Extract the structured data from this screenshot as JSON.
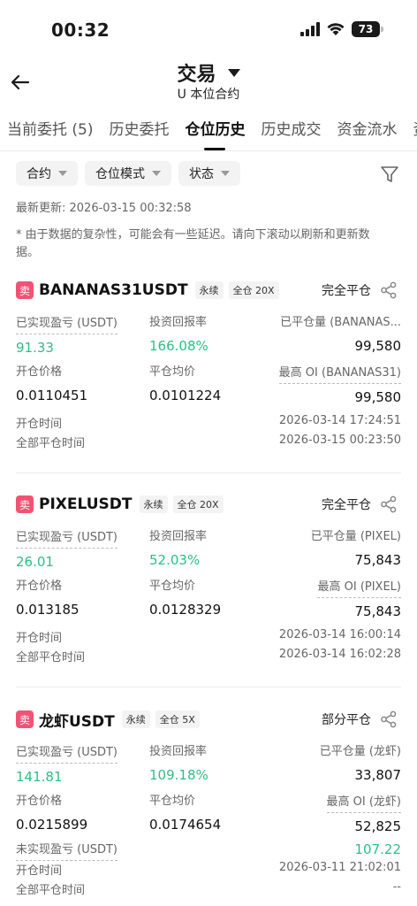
{
  "status_bar": {
    "time": "00:32",
    "battery": "73"
  },
  "header": {
    "title": "交易",
    "subtitle": "U 本位合约"
  },
  "tabs": [
    {
      "label": "当前委托 (5)"
    },
    {
      "label": "历史委托"
    },
    {
      "label": "仓位历史",
      "active": true
    },
    {
      "label": "历史成交"
    },
    {
      "label": "资金流水"
    },
    {
      "label": "资"
    }
  ],
  "filters": [
    {
      "label": "合约"
    },
    {
      "label": "仓位模式"
    },
    {
      "label": "状态"
    }
  ],
  "last_update": "最新更新: 2026-03-15 00:32:58",
  "notice": "* 由于数据的复杂性，可能会有一些延迟。请向下滚动以刷新和更新数据。",
  "colors": {
    "green": "#2ebd85",
    "sell": "#f25374"
  },
  "cards": [
    {
      "side": "卖",
      "symbol": "BANANAS31USDT",
      "tag_perp": "永续",
      "tag_margin": "全仓 20X",
      "status": "完全平仓",
      "realized_pnl_label": "已实现盈亏 (USDT)",
      "realized_pnl": "91.33",
      "roi_label": "投资回报率",
      "roi": "166.08%",
      "closed_qty_label": "已平仓量 (BANANAS...",
      "closed_qty": "99,580",
      "open_price_label": "开仓价格",
      "open_price": "0.0110451",
      "close_avg_label": "平仓均价",
      "close_avg": "0.0101224",
      "max_oi_label": "最高 OI (BANANAS31)",
      "max_oi": "99,580",
      "open_time_label": "开仓时间",
      "open_time": "2026-03-14 17:24:51",
      "close_time_label": "全部平仓时间",
      "close_time": "2026-03-15 00:23:50"
    },
    {
      "side": "卖",
      "symbol": "PIXELUSDT",
      "tag_perp": "永续",
      "tag_margin": "全仓 20X",
      "status": "完全平仓",
      "realized_pnl_label": "已实现盈亏 (USDT)",
      "realized_pnl": "26.01",
      "roi_label": "投资回报率",
      "roi": "52.03%",
      "closed_qty_label": "已平仓量 (PIXEL)",
      "closed_qty": "75,843",
      "open_price_label": "开仓价格",
      "open_price": "0.013185",
      "close_avg_label": "平仓均价",
      "close_avg": "0.0128329",
      "max_oi_label": "最高 OI (PIXEL)",
      "max_oi": "75,843",
      "open_time_label": "开仓时间",
      "open_time": "2026-03-14 16:00:14",
      "close_time_label": "全部平仓时间",
      "close_time": "2026-03-14 16:02:28"
    },
    {
      "side": "卖",
      "symbol": "龙虾USDT",
      "tag_perp": "永续",
      "tag_margin": "全仓 5X",
      "status": "部分平仓",
      "realized_pnl_label": "已实现盈亏 (USDT)",
      "realized_pnl": "141.81",
      "roi_label": "投资回报率",
      "roi": "109.18%",
      "closed_qty_label": "已平仓量 (龙虾)",
      "closed_qty": "33,807",
      "open_price_label": "开仓价格",
      "open_price": "0.0215899",
      "close_avg_label": "平仓均价",
      "close_avg": "0.0174654",
      "max_oi_label": "最高 OI (龙虾)",
      "max_oi": "52,825",
      "unrealized_pnl_label": "未实现盈亏 (USDT)",
      "unrealized_pnl": "107.22",
      "open_time_label": "开仓时间",
      "open_time": "2026-03-11 21:02:01",
      "close_time_label": "全部平仓时间",
      "close_time": "--"
    }
  ]
}
